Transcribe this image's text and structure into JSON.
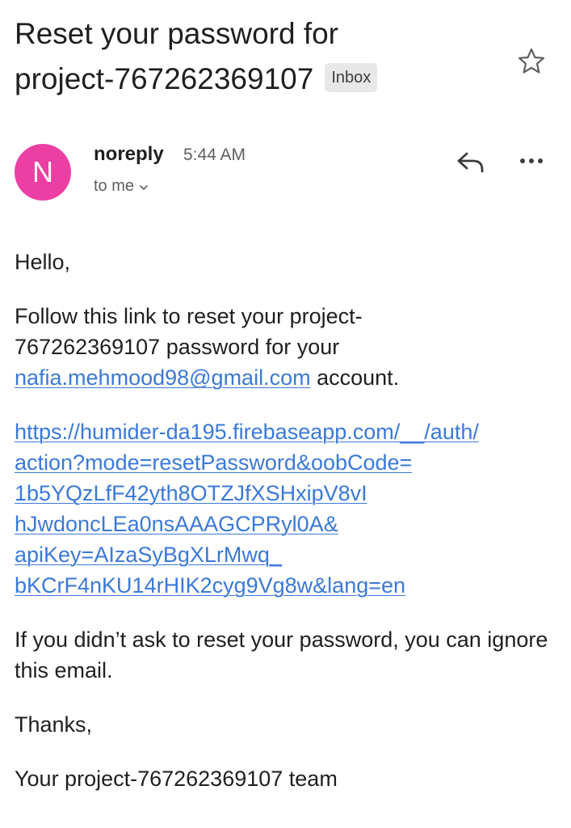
{
  "email": {
    "subject_line1": "Reset your password for",
    "subject_line2": "project-767262369107",
    "label": "Inbox",
    "star_icon": "star-outline-icon"
  },
  "header": {
    "avatar_letter": "N",
    "avatar_color": "#ec3fa4",
    "sender": "noreply",
    "time": "5:44 AM",
    "recipient": "to me",
    "reply_icon": "reply-icon",
    "more_icon": "more-horizontal-icon"
  },
  "body": {
    "greeting": "Hello,",
    "follow_text_before": "Follow this link to reset your project-",
    "follow_text_mid": "767262369107 password for your",
    "email_link": "nafia.mehmood98@gmail.com",
    "follow_text_after": " account.",
    "reset_url_lines": [
      "https://humider-da195.firebaseapp.com/__/auth/",
      "action?mode=resetPassword&oobCode=",
      "1b5YQzLfF42yth8OTZJfXSHxipV8vI",
      "hJwdoncLEa0nsAAAGCPRyl0A&",
      "apiKey=AIzaSyBgXLrMwq_",
      "bKCrF4nKU14rHIK2cyg9Vg8w&lang=en"
    ],
    "ignore_text": "If you didn’t ask to reset your password, you can ignore this email.",
    "thanks": "Thanks,",
    "signature": "Your project-767262369107 team"
  },
  "colors": {
    "link": "#3b79d8",
    "text": "#1f1f1f",
    "secondary": "#5f5f5f",
    "badge_bg": "#e8e8e8"
  }
}
